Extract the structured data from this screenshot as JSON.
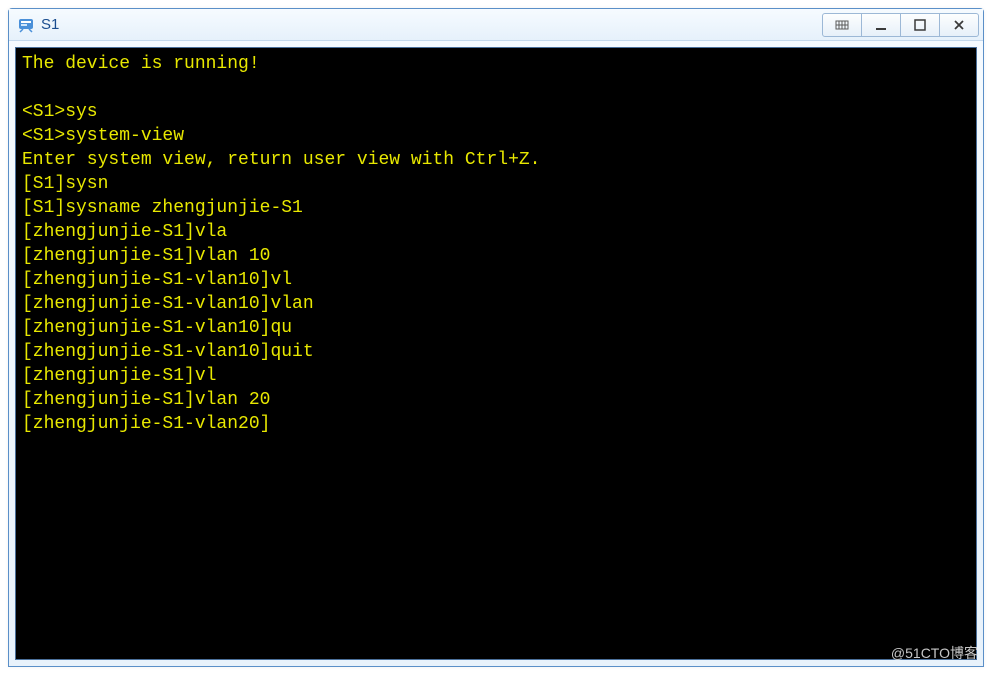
{
  "window": {
    "title": "S1"
  },
  "terminal": {
    "lines": [
      "The device is running!",
      "",
      "<S1>sys",
      "<S1>system-view",
      "Enter system view, return user view with Ctrl+Z.",
      "[S1]sysn",
      "[S1]sysname zhengjunjie-S1",
      "[zhengjunjie-S1]vla",
      "[zhengjunjie-S1]vlan 10",
      "[zhengjunjie-S1-vlan10]vl",
      "[zhengjunjie-S1-vlan10]vlan",
      "[zhengjunjie-S1-vlan10]qu",
      "[zhengjunjie-S1-vlan10]quit",
      "[zhengjunjie-S1]vl",
      "[zhengjunjie-S1]vlan 20",
      "[zhengjunjie-S1-vlan20]"
    ]
  },
  "watermark": "@51CTO博客"
}
